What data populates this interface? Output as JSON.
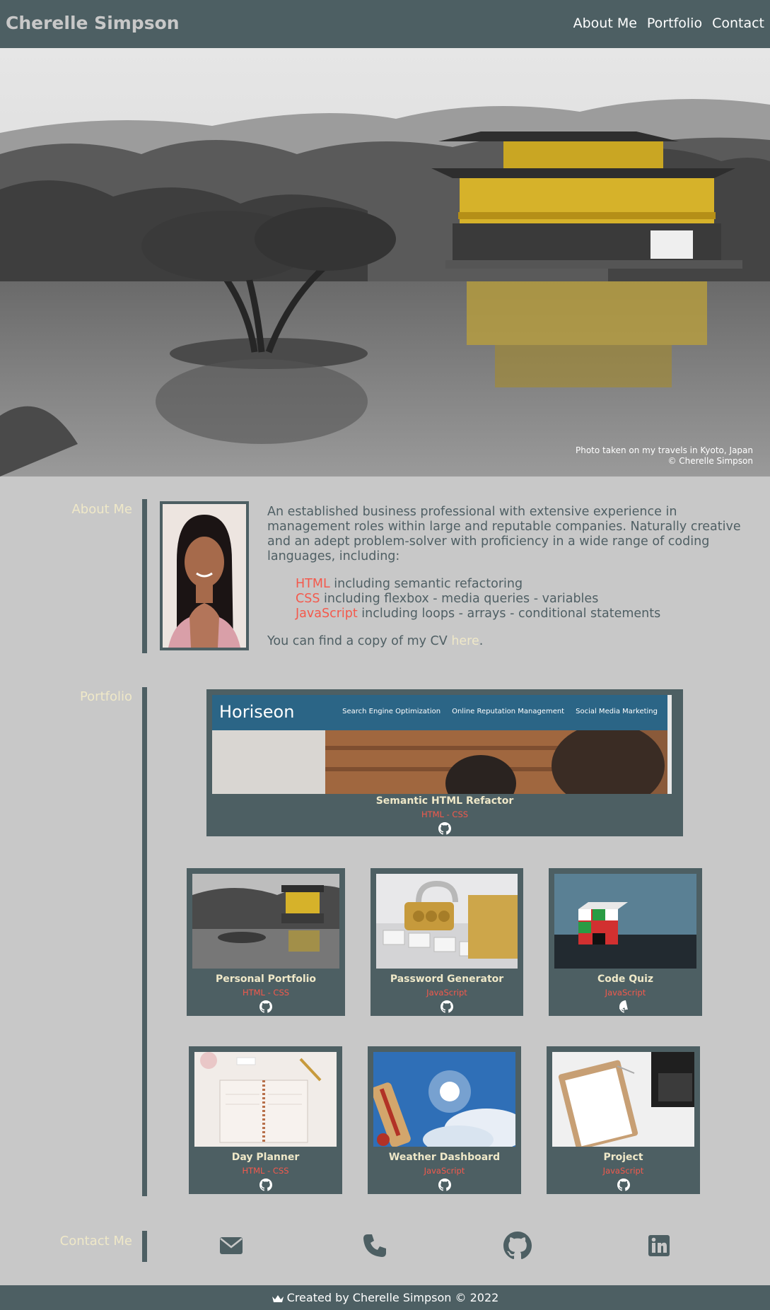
{
  "header": {
    "title": "Cherelle Simpson",
    "nav": [
      "About Me",
      "Portfolio",
      "Contact"
    ]
  },
  "hero": {
    "caption_line1": "Photo taken on my travels in Kyoto, Japan",
    "caption_line2": "© Cherelle Simpson"
  },
  "about": {
    "label": "About Me",
    "intro": "An established business professional with extensive experience in management roles within large and reputable companies. Naturally creative and an adept problem-solver with proficiency in a wide range of coding languages, including:",
    "skills": [
      {
        "name": "HTML",
        "detail": " including semantic refactoring"
      },
      {
        "name": "CSS",
        "detail": " including flexbox - media queries - variables"
      },
      {
        "name": "JavaScript",
        "detail": " including loops - arrays - conditional statements"
      }
    ],
    "cv_prefix": "You can find a copy of my CV ",
    "cv_link": "here",
    "cv_suffix": "."
  },
  "portfolio": {
    "label": "Portfolio",
    "featured": {
      "title": "Semantic HTML Refactor",
      "tech": "HTML - CSS",
      "preview_brand": "Horiseon",
      "preview_nav": [
        "Search Engine Optimization",
        "Online Reputation Management",
        "Social Media Marketing"
      ]
    },
    "projects": [
      {
        "title": "Personal Portfolio",
        "tech": "HTML - CSS"
      },
      {
        "title": "Password Generator",
        "tech": "JavaScript"
      },
      {
        "title": "Code Quiz",
        "tech": "JavaScript"
      },
      {
        "title": "Day Planner",
        "tech": "HTML - CSS"
      },
      {
        "title": "Weather Dashboard",
        "tech": "JavaScript"
      },
      {
        "title": "Project",
        "tech": "JavaScript"
      }
    ]
  },
  "contact": {
    "label": "Contact Me",
    "icons": [
      "envelope-icon",
      "phone-icon",
      "github-icon",
      "linkedin-icon"
    ]
  },
  "footer": {
    "text": "Created by Cherelle Simpson © 2022"
  },
  "colors": {
    "header_bg": "#4d5f63",
    "page_bg": "#c8c8c8",
    "accent_red": "#f4594c",
    "accent_cream": "#efe8c8"
  }
}
